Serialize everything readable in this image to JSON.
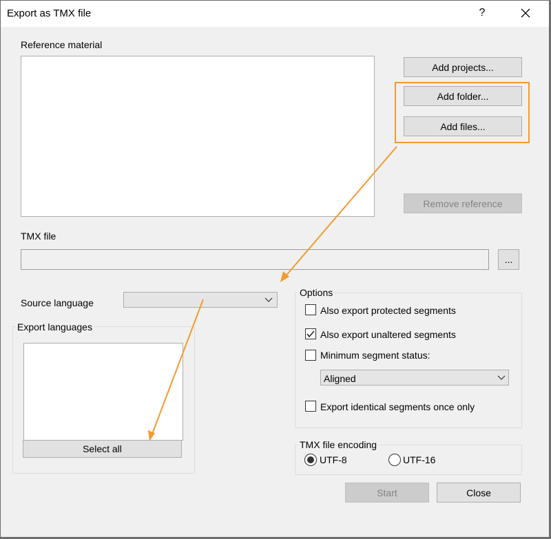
{
  "window": {
    "title": "Export as TMX file",
    "help": "?"
  },
  "reference": {
    "label": "Reference material",
    "add_projects": "Add projects...",
    "add_folder": "Add folder...",
    "add_files": "Add files...",
    "remove_reference": "Remove reference"
  },
  "tmx_file": {
    "label": "TMX file",
    "value": "",
    "browse": "..."
  },
  "source_language": {
    "label": "Source language",
    "value": ""
  },
  "export_languages": {
    "label": "Export languages",
    "select_all": "Select all"
  },
  "options": {
    "title": "Options",
    "protected": {
      "label": "Also export protected segments",
      "checked": false
    },
    "unaltered": {
      "label": "Also export unaltered segments",
      "checked": true
    },
    "min_status": {
      "label": "Minimum segment status:",
      "checked": false
    },
    "status_value": "Aligned",
    "identical": {
      "label": "Export identical segments once only",
      "checked": false
    }
  },
  "encoding": {
    "title": "TMX file encoding",
    "utf8": "UTF-8",
    "utf16": "UTF-16",
    "selected": "UTF-8"
  },
  "footer": {
    "start": "Start",
    "close": "Close"
  },
  "colors": {
    "annotation": "#f39a2e",
    "dialog_bg": "#f0f0f0",
    "button_bg": "#e1e1e1"
  }
}
